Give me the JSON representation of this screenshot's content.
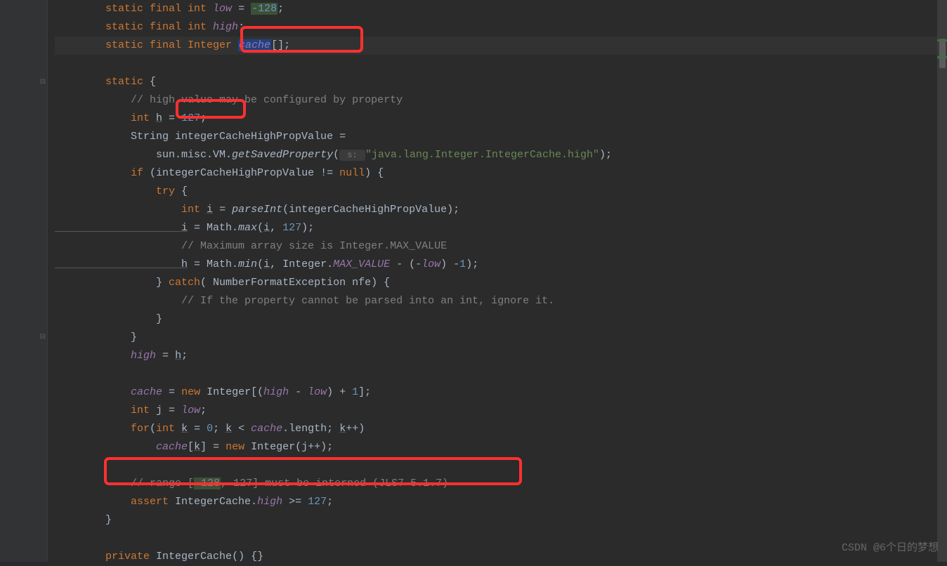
{
  "code": {
    "l1_pre": "        static final int ",
    "l1_field": "low",
    "l1_eq": " = ",
    "l1_val": "-128",
    "l1_end": ";",
    "l2_pre": "        static final int ",
    "l2_field": "high",
    "l2_end": ";",
    "l3_pre": "        static final Integer ",
    "l3_field": "cache",
    "l3_end": "[];",
    "l5_static": "        static ",
    "l5_brace": "{",
    "l6": "            // high value may be configured by property",
    "l7_pre": "            int ",
    "l7_var": "h",
    "l7_eq": " = ",
    "l7_val": "127",
    "l7_end": ";",
    "l8_pre": "            String integerCacheHighPropValue =",
    "l9_pre": "                sun.misc.VM.",
    "l9_method": "getSavedProperty",
    "l9_open": "(",
    "l9_hint": " s: ",
    "l9_str": "\"java.lang.Integer.IntegerCache.high\"",
    "l9_end": ");",
    "l10_if": "            if ",
    "l10_cond": "(integerCacheHighPropValue != ",
    "l10_null": "null",
    "l10_end": ") {",
    "l11_try": "                try ",
    "l11_brace": "{",
    "l12_pre": "                    int ",
    "l12_var": "i",
    "l12_eq": " = ",
    "l12_method": "parseInt",
    "l12_end": "(integerCacheHighPropValue);",
    "l13_var": "                    i",
    "l13_eq": " = Math.",
    "l13_method": "max",
    "l13_args": "(",
    "l13_i": "i",
    "l13_comma": ", ",
    "l13_val": "127",
    "l13_end": ");",
    "l14": "                    // Maximum array size is Integer.MAX_VALUE",
    "l15_var": "                    h",
    "l15_eq": " = Math.",
    "l15_method": "min",
    "l15_open": "(",
    "l15_i": "i",
    "l15_c1": ", Integer.",
    "l15_const": "MAX_VALUE",
    "l15_c2": " - (-",
    "l15_low": "low",
    "l15_c3": ") -",
    "l15_one": "1",
    "l15_end": ");",
    "l16_pre": "                } ",
    "l16_catch": "catch",
    "l16_args": "( NumberFormatException nfe) {",
    "l17": "                    // If the property cannot be parsed into an int, ignore it.",
    "l18": "                }",
    "l19": "            }",
    "l20_pre": "            ",
    "l20_high": "high",
    "l20_eq": " = ",
    "l20_h": "h",
    "l20_end": ";",
    "l22_pre": "            ",
    "l22_cache": "cache",
    "l22_eq": " = ",
    "l22_new": "new ",
    "l22_type": "Integer[(",
    "l22_high": "high",
    "l22_minus": " - ",
    "l22_low": "low",
    "l22_plus": ") + ",
    "l22_one": "1",
    "l22_end": "];",
    "l23_pre": "            int ",
    "l23_j": "j",
    "l23_eq": " = ",
    "l23_low": "low",
    "l23_end": ";",
    "l24_for": "            for",
    "l24_open": "(",
    "l24_int": "int ",
    "l24_k": "k",
    "l24_eq": " = ",
    "l24_zero": "0",
    "l24_semi": "; ",
    "l24_k2": "k",
    "l24_lt": " < ",
    "l24_cache": "cache",
    "l24_len": ".length; ",
    "l24_k3": "k",
    "l24_end": "++)",
    "l25_pre": "                ",
    "l25_cache": "cache",
    "l25_open": "[",
    "l25_k": "k",
    "l25_close": "] = ",
    "l25_new": "new ",
    "l25_int": "Integer(j++);",
    "l27_pre": "            // range [",
    "l27_neg": "-128",
    "l27_rest": ", 127] must be interned (JLS7 5.1.7)",
    "l28_pre": "            assert ",
    "l28_class": "IntegerCache.",
    "l28_high": "high",
    "l28_gte": " >= ",
    "l28_val": "127",
    "l28_end": ";",
    "l29": "        }",
    "l31_pre": "        private ",
    "l31_name": "IntegerCache",
    "l31_end": "() {}"
  },
  "watermark": "CSDN @6个日的梦想"
}
